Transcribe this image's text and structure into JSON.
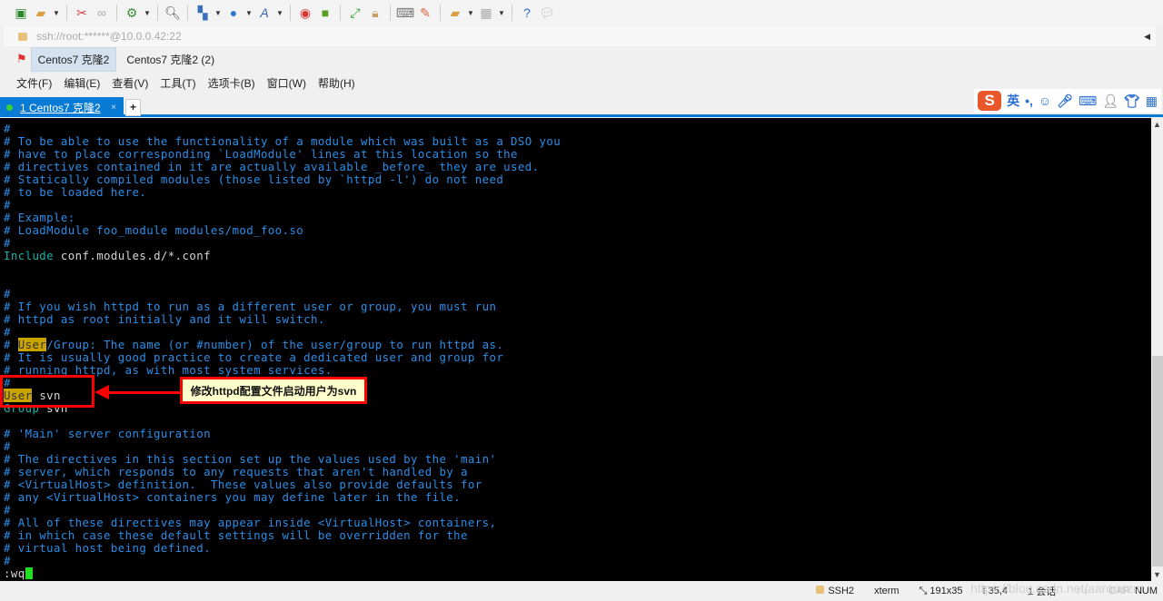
{
  "toolbar": {
    "icons": [
      "new-session-icon",
      "open-folder-icon",
      "disconnect-icon",
      "reconnect-icon",
      "properties-icon",
      "find-icon",
      "layout-icon",
      "globe-icon",
      "font-icon",
      "xftp-icon",
      "xshell-green-icon",
      "fullscreen-icon",
      "lock-icon",
      "keyboard-icon",
      "highlight-icon",
      "new-tab-icon",
      "panes-icon",
      "help-icon",
      "chat-icon"
    ]
  },
  "address": {
    "value": "ssh://root:******@10.0.0.42:22"
  },
  "bookmarks": [
    {
      "label": "Centos7 克隆2"
    },
    {
      "label": "Centos7 克隆2 (2)"
    }
  ],
  "menu": [
    {
      "label": "文件(F)"
    },
    {
      "label": "编辑(E)"
    },
    {
      "label": "查看(V)"
    },
    {
      "label": "工具(T)"
    },
    {
      "label": "选项卡(B)"
    },
    {
      "label": "窗口(W)"
    },
    {
      "label": "帮助(H)"
    }
  ],
  "tabs": [
    {
      "label": "1 Centos7 克隆2",
      "status_color": "#3bd13b",
      "close": "×"
    }
  ],
  "new_tab": "+",
  "ime": {
    "logo": "S",
    "lang": "英",
    "punct": "•,"
  },
  "terminal": {
    "lines": [
      [
        [
          "#",
          "comment"
        ]
      ],
      [
        [
          "# To be able to use the functionality of a module which was built as a DSO you",
          "comment"
        ]
      ],
      [
        [
          "# have to place corresponding `LoadModule' lines at this location so the",
          "comment"
        ]
      ],
      [
        [
          "# directives contained in it are actually available _before_ they are used.",
          "comment"
        ]
      ],
      [
        [
          "# Statically compiled modules (those listed by `httpd -l') do not need",
          "comment"
        ]
      ],
      [
        [
          "# to be loaded here.",
          "comment"
        ]
      ],
      [
        [
          "#",
          "comment"
        ]
      ],
      [
        [
          "# Example:",
          "comment"
        ]
      ],
      [
        [
          "# LoadModule foo_module modules/mod_foo.so",
          "comment"
        ]
      ],
      [
        [
          "#",
          "comment"
        ]
      ],
      [
        [
          "Include",
          "keyword"
        ],
        [
          " conf.modules.d/*.conf",
          "plain"
        ]
      ],
      [],
      [],
      [
        [
          "#",
          "comment"
        ]
      ],
      [
        [
          "# If you wish httpd to run as a different user or group, you must run",
          "comment"
        ]
      ],
      [
        [
          "# httpd as root initially and it will switch.",
          "comment"
        ]
      ],
      [
        [
          "#",
          "comment"
        ]
      ],
      [
        [
          "# ",
          "comment"
        ],
        [
          "User",
          "hl"
        ],
        [
          "/Group: The name (or #number) of the user/group to run httpd as.",
          "comment"
        ]
      ],
      [
        [
          "# It is usually good practice to create a dedicated user and group for",
          "comment"
        ]
      ],
      [
        [
          "# running httpd, as with most system services.",
          "comment"
        ]
      ],
      [
        [
          "#",
          "comment"
        ]
      ],
      [
        [
          "User",
          "hl"
        ],
        [
          " svn",
          "plain"
        ]
      ],
      [
        [
          "Group",
          "keyword"
        ],
        [
          " svn",
          "plain"
        ]
      ],
      [],
      [
        [
          "# 'Main' server configuration",
          "comment"
        ]
      ],
      [
        [
          "#",
          "comment"
        ]
      ],
      [
        [
          "# The directives in this section set up the values used by the 'main'",
          "comment"
        ]
      ],
      [
        [
          "# server, which responds to any requests that aren't handled by a",
          "comment"
        ]
      ],
      [
        [
          "# <VirtualHost> definition.  These values also provide defaults for",
          "comment"
        ]
      ],
      [
        [
          "# any <VirtualHost> containers you may define later in the file.",
          "comment"
        ]
      ],
      [
        [
          "#",
          "comment"
        ]
      ],
      [
        [
          "# All of these directives may appear inside <VirtualHost> containers,",
          "comment"
        ]
      ],
      [
        [
          "# in which case these default settings will be overridden for the",
          "comment"
        ]
      ],
      [
        [
          "# virtual host being defined.",
          "comment"
        ]
      ],
      [
        [
          "#",
          "comment"
        ]
      ],
      [
        [
          ":wq",
          "plain"
        ]
      ]
    ]
  },
  "annotation": {
    "text": "修改httpd配置文件启动用户为svn",
    "color": "#ff0000"
  },
  "status": {
    "protocol": "SSH2",
    "term": "xterm",
    "size": "191x35",
    "cursor": "35,4",
    "sessions": "1 会话",
    "cap": "CAP",
    "num": "NUM"
  },
  "watermark": "https://blog.csdn.net/aaronszm",
  "colors": {
    "accent": "#0a7bd5",
    "comment": "#2a8ee8",
    "keyword": "#18b0a8",
    "highlight": "#c9a400",
    "cursor": "#1ee01e"
  }
}
